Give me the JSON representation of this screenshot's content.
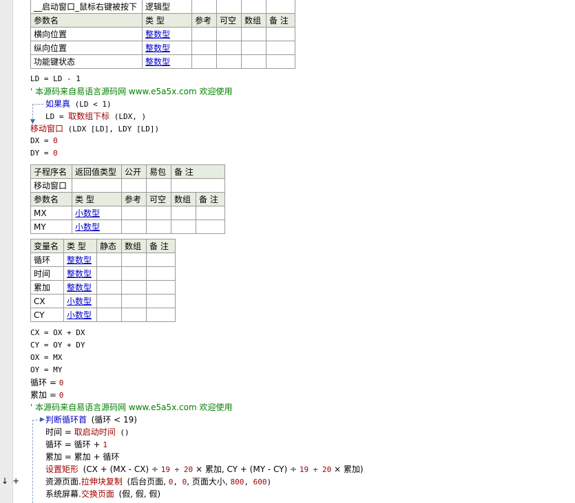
{
  "gutter": {
    "arrow_glyph": "↓",
    "plus_glyph": "+"
  },
  "table_event": {
    "name": "__启动窗口_鼠标右键被按下",
    "return_type": "逻辑型",
    "param_headers": [
      "参数名",
      "类 型",
      "参考",
      "可空",
      "数组",
      "备 注"
    ],
    "params": [
      {
        "name": "横向位置",
        "type": "整数型"
      },
      {
        "name": "纵向位置",
        "type": "整数型"
      },
      {
        "name": "功能键状态",
        "type": "整数型"
      }
    ]
  },
  "code_a": {
    "l1": "LD = LD - 1",
    "comment": "' 本源码来自易语言源码网 www.e5a5x.com  欢迎使用",
    "if_kw": "如果真",
    "if_cond": "(LD < 1)",
    "assign_ld_lhs": "LD = ",
    "assign_ld_fn": "取数组下标",
    "assign_ld_args": "(LDX, )",
    "move_fn": "移动窗口",
    "move_args": "(LDX [LD], LDY [LD])",
    "dx": "DX = ",
    "dx_val": "0",
    "dy": "DY = ",
    "dy_val": "0"
  },
  "table_sub": {
    "headers": [
      "子程序名",
      "返回值类型",
      "公开",
      "易包",
      "备 注"
    ],
    "name": "移动窗口",
    "param_headers": [
      "参数名",
      "类 型",
      "参考",
      "可空",
      "数组",
      "备 注"
    ],
    "params": [
      {
        "name": "MX",
        "type": "小数型"
      },
      {
        "name": "MY",
        "type": "小数型"
      }
    ]
  },
  "table_vars": {
    "headers": [
      "变量名",
      "类 型",
      "静态",
      "数组",
      "备 注"
    ],
    "vars": [
      {
        "name": "循环",
        "type": "整数型"
      },
      {
        "name": "时间",
        "type": "整数型"
      },
      {
        "name": "累加",
        "type": "整数型"
      },
      {
        "name": "CX",
        "type": "小数型"
      },
      {
        "name": "CY",
        "type": "小数型"
      }
    ]
  },
  "code_b": {
    "cx": "CX = OX + DX",
    "cy": "CY = OY + DY",
    "ox": "OX = MX",
    "oy": "OY = MY",
    "loop_init_lhs": "循环 = ",
    "loop_init_val": "0",
    "acc_init_lhs": "累加 = ",
    "acc_init_val": "0",
    "comment": "' 本源码来自易语言源码网 www.e5a5x.com  欢迎使用",
    "while_kw": "判断循环首",
    "while_cond": "(循环 < 19)",
    "time_lhs": "时间 = ",
    "time_fn": "取启动时间",
    "time_args": "()",
    "loop_inc_lhs": "循环 = 循环 + ",
    "loop_inc_val": "1",
    "acc_inc": "累加 = 累加 + 循环",
    "rect_fn": "设置矩形",
    "rect_args_a": "(CX + (MX - CX) ÷ ",
    "rect_n1": "19",
    "rect_div": " ÷ ",
    "rect_n2": "20",
    "rect_args_b": " × 累加, CY + (MY - CY) ÷ ",
    "rect_n3": "19",
    "rect_div2": " ÷ ",
    "rect_n4": "20",
    "rect_args_c": " × 累加)",
    "res_obj": "资源页面.",
    "res_fn": "拉伸块复制",
    "res_args_a": "(后台页面, ",
    "res_n1": "0",
    "res_sep": ", ",
    "res_n2": "0",
    "res_args_b": ", 页面大小, ",
    "res_n3": "800",
    "res_sep2": ", ",
    "res_n4": "600",
    "res_args_c": ")",
    "sys_obj": "系统屏幕.",
    "sys_fn": "交换页面",
    "sys_args": "(假, 假, 假)"
  }
}
